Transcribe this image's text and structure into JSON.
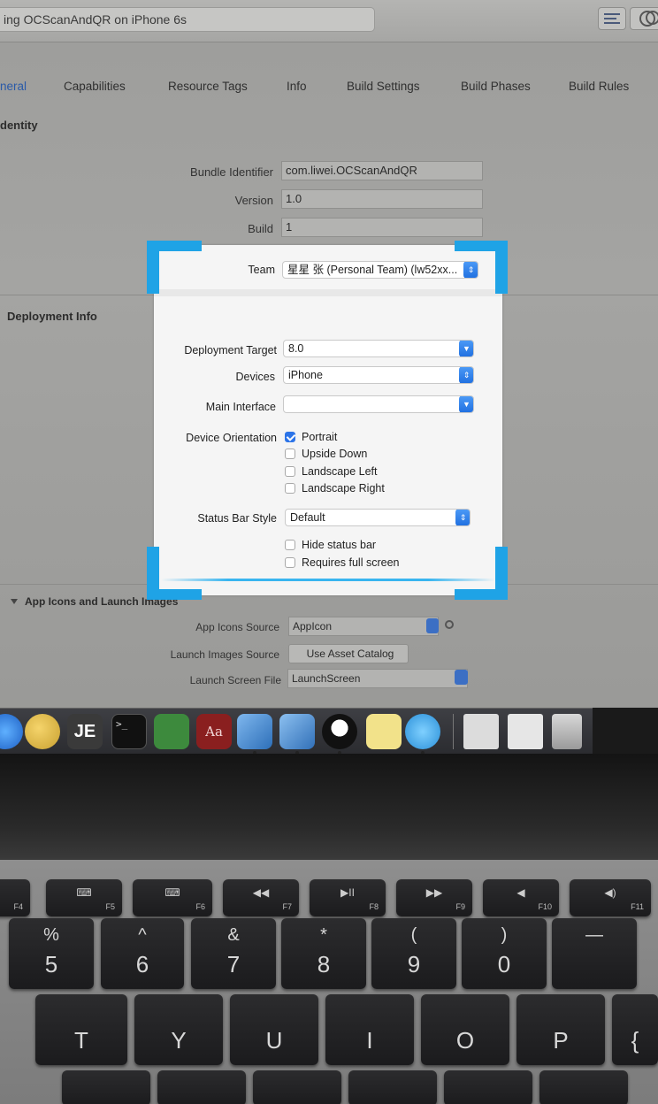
{
  "toolbar": {
    "scheme_text": "ing OCScanAndQR on iPhone 6s"
  },
  "tabs": [
    {
      "label": "neral"
    },
    {
      "label": "Capabilities"
    },
    {
      "label": "Resource Tags"
    },
    {
      "label": "Info"
    },
    {
      "label": "Build Settings"
    },
    {
      "label": "Build Phases"
    },
    {
      "label": "Build Rules"
    }
  ],
  "identity": {
    "section_title": "dentity",
    "bundle_label": "Bundle Identifier",
    "bundle_value": "com.liwei.OCScanAndQR",
    "version_label": "Version",
    "version_value": "1.0",
    "build_label": "Build",
    "build_value": "1"
  },
  "deployment": {
    "section_title": "Deployment Info"
  },
  "scan": {
    "team_label": "Team",
    "team_value": "星星 张 (Personal Team) (lw52xx...",
    "deployment_target_label": "Deployment Target",
    "deployment_target_value": "8.0",
    "devices_label": "Devices",
    "devices_value": "iPhone",
    "main_interface_label": "Main Interface",
    "main_interface_value": "",
    "orientation_label": "Device Orientation",
    "orientation_options": [
      {
        "label": "Portrait",
        "checked": true
      },
      {
        "label": "Upside Down",
        "checked": false
      },
      {
        "label": "Landscape Left",
        "checked": false
      },
      {
        "label": "Landscape Right",
        "checked": false
      }
    ],
    "status_bar_label": "Status Bar Style",
    "status_bar_value": "Default",
    "hide_status_bar": "Hide status bar",
    "requires_full_screen": "Requires full screen",
    "accent_color": "#1fa3e6"
  },
  "app_icons": {
    "section_title": "App Icons and Launch Images",
    "icons_source_label": "App Icons Source",
    "icons_source_value": "AppIcon",
    "launch_images_label": "Launch Images Source",
    "launch_images_button": "Use Asset Catalog",
    "launch_screen_label": "Launch Screen File",
    "launch_screen_value": "LaunchScreen"
  },
  "dock": {
    "icons": [
      "safari-icon",
      "finder-like-icon",
      "jetbrains-icon",
      "terminal-icon",
      "evernote-icon",
      "dictionary-icon",
      "xcode-icon",
      "xcode-alt-icon",
      "qq-icon",
      "notes-icon",
      "chat-icon",
      "screenshot-icon",
      "preview-icon",
      "trash-icon"
    ],
    "dictionary_glyph": "Aa",
    "jetbrains_glyph": "JE",
    "terminal_glyph": ">_"
  },
  "keyboard": {
    "function_row": [
      {
        "fn": "F4",
        "glyph": ""
      },
      {
        "fn": "F5",
        "glyph": "⌨"
      },
      {
        "fn": "F6",
        "glyph": "⌨"
      },
      {
        "fn": "F7",
        "glyph": "◀◀"
      },
      {
        "fn": "F8",
        "glyph": "▶II"
      },
      {
        "fn": "F9",
        "glyph": "▶▶"
      },
      {
        "fn": "F10",
        "glyph": "◀"
      },
      {
        "fn": "F11",
        "glyph": "◀)"
      }
    ],
    "number_row": [
      {
        "top": "%",
        "main": "5"
      },
      {
        "top": "^",
        "main": "6"
      },
      {
        "top": "&",
        "main": "7"
      },
      {
        "top": "*",
        "main": "8"
      },
      {
        "top": "(",
        "main": "9"
      },
      {
        "top": ")",
        "main": "0"
      },
      {
        "top": "—",
        "main": ""
      }
    ],
    "letter_row": [
      "T",
      "Y",
      "U",
      "I",
      "O",
      "P",
      "{"
    ]
  }
}
